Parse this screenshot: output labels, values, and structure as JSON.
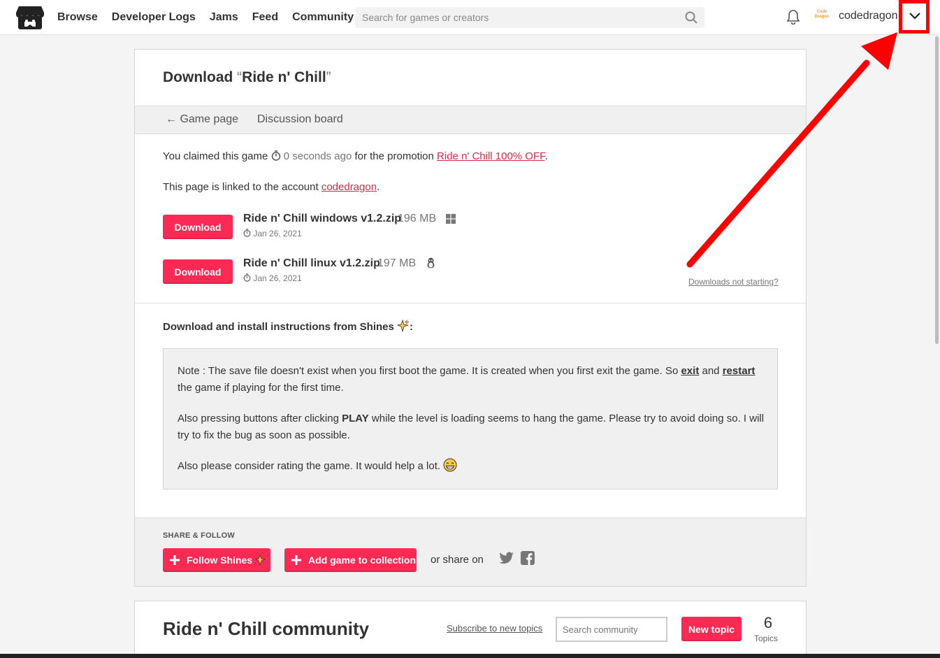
{
  "header": {
    "nav": [
      "Browse",
      "Developer Logs",
      "Jams",
      "Feed",
      "Community"
    ],
    "search_placeholder": "Search for games or creators",
    "username": "codedragon",
    "avatar_text": "Code Dragon"
  },
  "page": {
    "title_prefix": "Download",
    "open_quote": "“",
    "game_title": "Ride n' Chill",
    "close_quote": "”",
    "subnav": {
      "game_page": "← Game page",
      "discussion": "Discussion board"
    },
    "claim": {
      "prefix": "You claimed this game",
      "time": "0 seconds ago",
      "middle": "for the promotion",
      "promo": "Ride n' Chill 100% OFF",
      "suffix": "."
    },
    "linked": {
      "prefix": "This page is linked to the account",
      "account": "codedragon",
      "suffix": "."
    },
    "files": [
      {
        "button": "Download",
        "name": "Ride n' Chill windows v1.2.zip",
        "size": "196 MB",
        "date": "Jan 26, 2021",
        "platform_icon": "windows-icon"
      },
      {
        "button": "Download",
        "name": "Ride n' Chill linux v1.2.zip",
        "size": "197 MB",
        "date": "Jan 26, 2021",
        "platform_icon": "linux-icon"
      }
    ],
    "not_starting": "Downloads not starting?",
    "instructions_heading": "Download and install instructions from Shines",
    "instructions_colon": ":",
    "note": {
      "p1_a": "Note : The save file doesn't exist when you first boot the game. It is created when you first exit the game. So ",
      "p1_exit": "exit",
      "p1_b": " and ",
      "p1_restart": "restart",
      "p1_c": " the game if playing for the first time.",
      "p2_a": "Also pressing buttons after clicking ",
      "p2_play": "PLAY",
      "p2_b": " while the level is loading seems to hang the game. Please try to avoid doing so. I will try to fix the bug as soon as possible.",
      "p3": "Also please consider rating the game. It would help a lot."
    },
    "share": {
      "label": "SHARE & FOLLOW",
      "follow": "Follow Shines",
      "add_collection": "Add game to collection",
      "share_on": "or share on"
    }
  },
  "community": {
    "title": "Ride n' Chill community",
    "subscribe": "Subscribe to new topics",
    "search_placeholder": "Search community",
    "new_topic": "New topic",
    "topics_count": "6",
    "topics_label": "Topics"
  },
  "colors": {
    "accent": "#fa2a55",
    "link": "#da2c4a",
    "annotation": "#ff0000"
  }
}
